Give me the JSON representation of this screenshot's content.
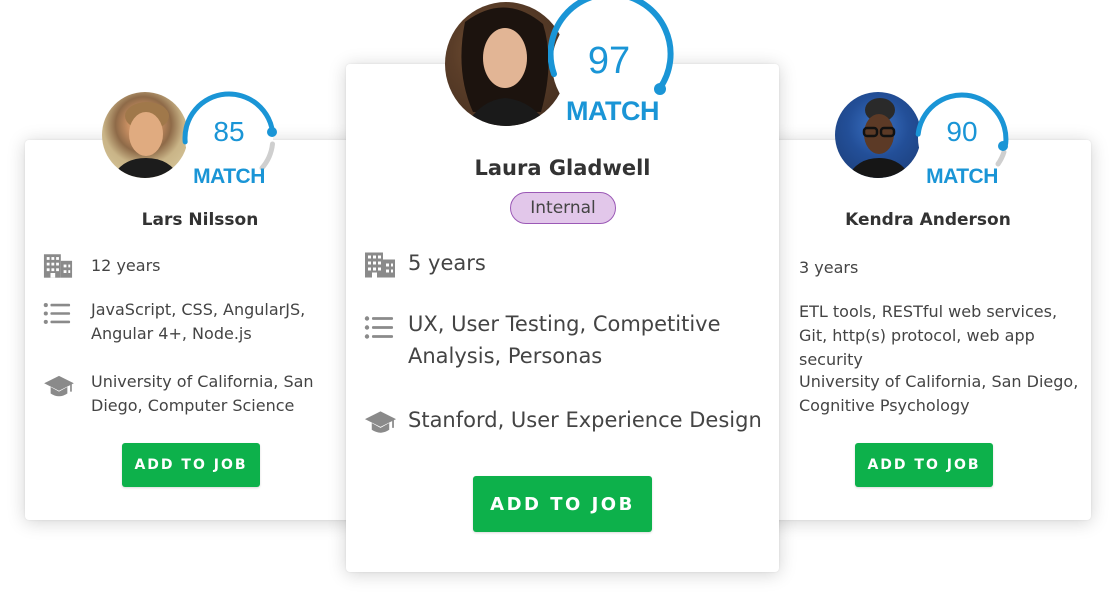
{
  "candidates": {
    "left": {
      "score": "85",
      "match_label": "MATCH",
      "name": "Lars Nilsson",
      "experience": "12 years",
      "skills": "JavaScript, CSS, AngularJS, Angular 4+, Node.js",
      "education": "University of California, San Diego, Computer Science",
      "button_label": "ADD TO JOB"
    },
    "center": {
      "score": "97",
      "match_label": "MATCH",
      "name": "Laura Gladwell",
      "tag": "Internal",
      "experience": "5 years",
      "skills": "UX, User Testing, Competitive Analysis, Personas",
      "education": "Stanford, User Experience Design",
      "button_label": "ADD TO JOB"
    },
    "right": {
      "score": "90",
      "match_label": "MATCH",
      "name": "Kendra Anderson",
      "experience": "3 years",
      "skills": "ETL tools, RESTful web services, Git, http(s) protocol, web app security",
      "education": "University of California, San Diego, Cognitive Psychology",
      "button_label": "ADD TO JOB"
    }
  },
  "icons": {
    "experience": "building-icon",
    "skills": "list-icon",
    "education": "graduation-cap-icon"
  },
  "colors": {
    "accent": "#1a95d6",
    "button": "#0db14b",
    "tag_bg": "#e2c7ea",
    "tag_border": "#9b59b6",
    "icon": "#888888"
  }
}
